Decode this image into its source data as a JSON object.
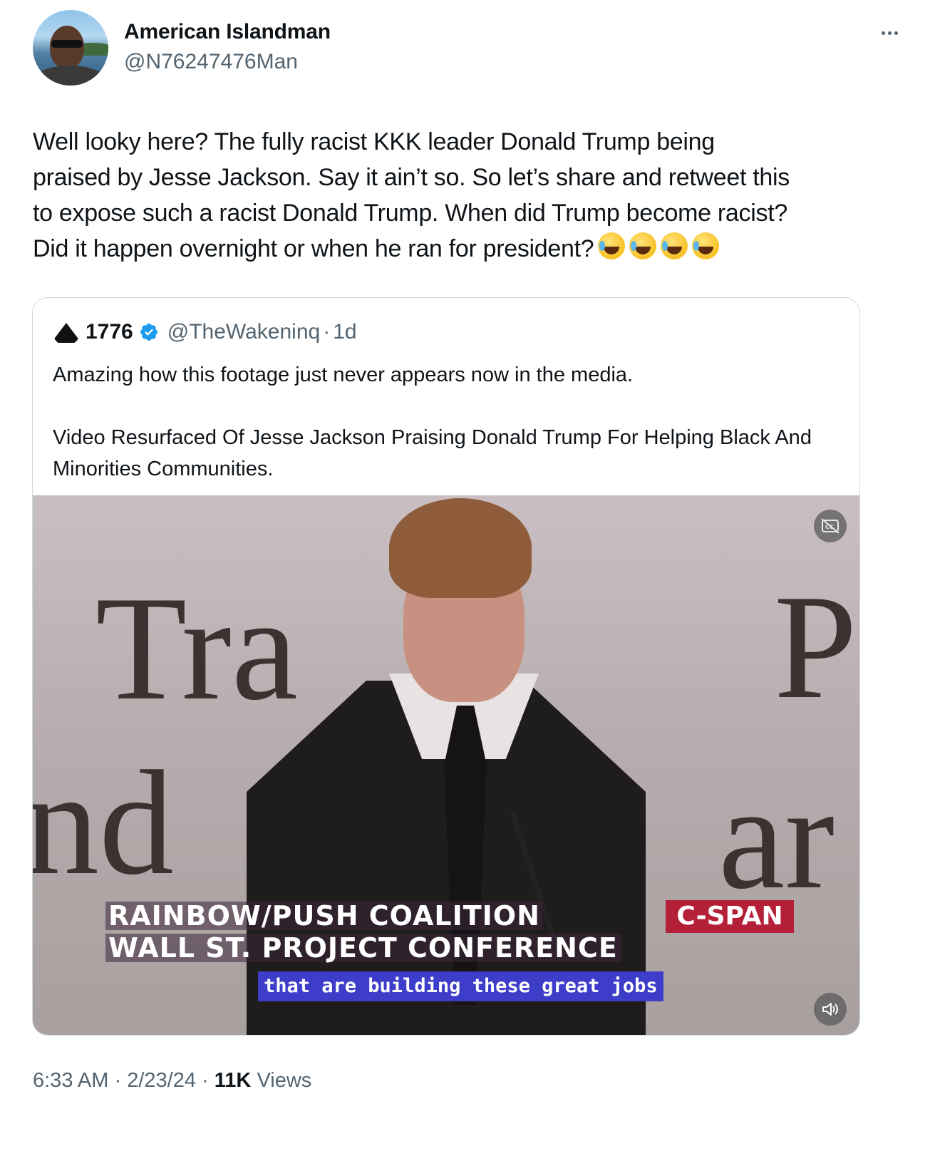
{
  "author": {
    "name": "American Islandman",
    "handle": "@N76247476Man"
  },
  "tweet": {
    "lines": [
      "Well looky here? The fully racist KKK leader Donald Trump being",
      "praised by Jesse Jackson. Say it ain’t so. So let’s share and retweet this",
      "to expose such a racist Donald Trump. When did Trump become racist?",
      "Did it happen overnight or when he ran for president?"
    ],
    "emojis": [
      "😂",
      "😂",
      "🤣",
      "🤣"
    ]
  },
  "quote": {
    "name": "1776",
    "handle": "@TheWakeninq",
    "separator": "·",
    "time": "1d",
    "paragraphs": [
      "Amazing how this footage just never appears now in the media.",
      "Video Resurfaced Of Jesse Jackson Praising Donald Trump For Helping Black And Minorities Communities."
    ],
    "video": {
      "caption_line1": "RAINBOW/PUSH COALITION",
      "caption_line2": "WALL ST. PROJECT CONFERENCE",
      "network": "C-SPAN",
      "subtitle": "that are building these great jobs",
      "backdrop_words": [
        "Tra",
        "P",
        "nd",
        "ar"
      ]
    }
  },
  "footer": {
    "time": "6:33 AM",
    "sep": "·",
    "date": "2/23/24",
    "views_count": "11K",
    "views_label": "Views"
  },
  "icons": {
    "more": "more-dots-icon",
    "verified": "verified-badge-icon",
    "captions": "captions-off-icon",
    "volume": "volume-icon"
  },
  "colors": {
    "text": "#0f1419",
    "secondary": "#536471",
    "border": "#cfd9de",
    "verified": "#1d9bf0",
    "cspan": "#b32037",
    "subtitle_bg": "#3d3dc9"
  }
}
